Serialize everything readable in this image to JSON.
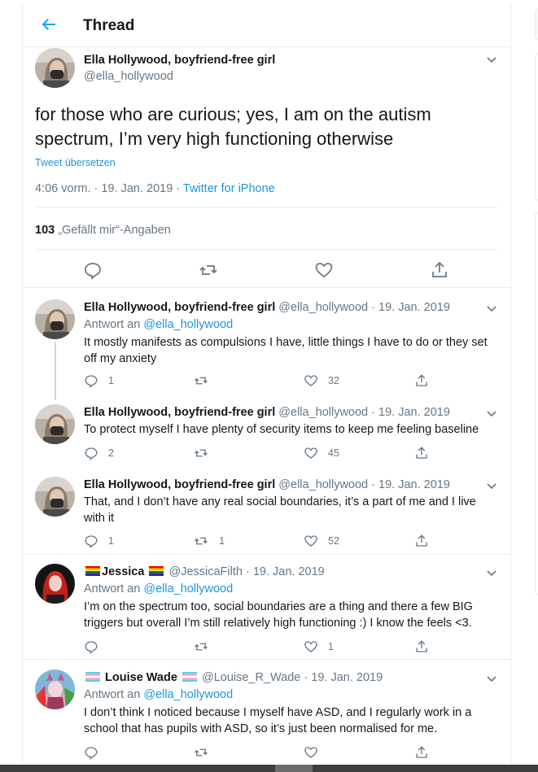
{
  "header": {
    "title": "Thread",
    "back_icon": "arrow-left-icon"
  },
  "main_tweet": {
    "name": "Ella Hollywood, boyfriend-free girl",
    "handle": "@ella_hollywood",
    "text": "for those who are curious; yes, I am on the autism spectrum, I’m very high functioning otherwise",
    "translate": "Tweet übersetzen",
    "time": "4:06 vorm. · 19. Jan. 2019 · ",
    "source": "Twitter for iPhone",
    "likes_count": "103",
    "likes_label": " „Gefällt mir“-Angaben"
  },
  "replies": [
    {
      "name": "Ella Hollywood, boyfriend-free girl",
      "handle": "@ella_hollywood",
      "date": "· 19. Jan. 2019",
      "reply_prefix": "Antwort an ",
      "reply_to": "@ella_hollywood",
      "text": "It mostly manifests as compulsions I have, little things I have to do or they set off my anxiety",
      "reply_count": "1",
      "retweet_count": "",
      "like_count": "32"
    },
    {
      "name": "Ella Hollywood, boyfriend-free girl",
      "handle": "@ella_hollywood",
      "date": "· 19. Jan. 2019",
      "text": "To protect myself I have plenty of security items to keep me feeling baseline",
      "reply_count": "2",
      "retweet_count": "",
      "like_count": "45"
    },
    {
      "name": "Ella Hollywood, boyfriend-free girl",
      "handle": "@ella_hollywood",
      "date": "· 19. Jan. 2019",
      "text": "That, and I don’t have any real social boundaries, it’s a part of me and I live with it",
      "reply_count": "1",
      "retweet_count": "1",
      "like_count": "52"
    },
    {
      "name": "Jessica",
      "handle": "@JessicaFilth",
      "date": "· 19. Jan. 2019",
      "reply_prefix": "Antwort an ",
      "reply_to": "@ella_hollywood",
      "text": "I’m on the spectrum too, social boundaries are a thing and there a few BIG triggers but overall I’m still relatively high functioning :) I know the feels <3.",
      "reply_count": "",
      "retweet_count": "",
      "like_count": "1"
    },
    {
      "name": "Louise Wade",
      "handle": "@Louise_R_Wade",
      "date": "· 19. Jan. 2019",
      "reply_prefix": "Antwort an ",
      "reply_to": "@ella_hollywood",
      "text": "I don’t think I noticed because I myself have ASD, and I regularly work in a school that has pupils with ASD, so it’s just been normalised for me.",
      "reply_count": "",
      "retweet_count": "",
      "like_count": ""
    }
  ],
  "colors": {
    "accent": "#1b95e0",
    "muted": "#657786",
    "border": "#e6ecf0"
  }
}
